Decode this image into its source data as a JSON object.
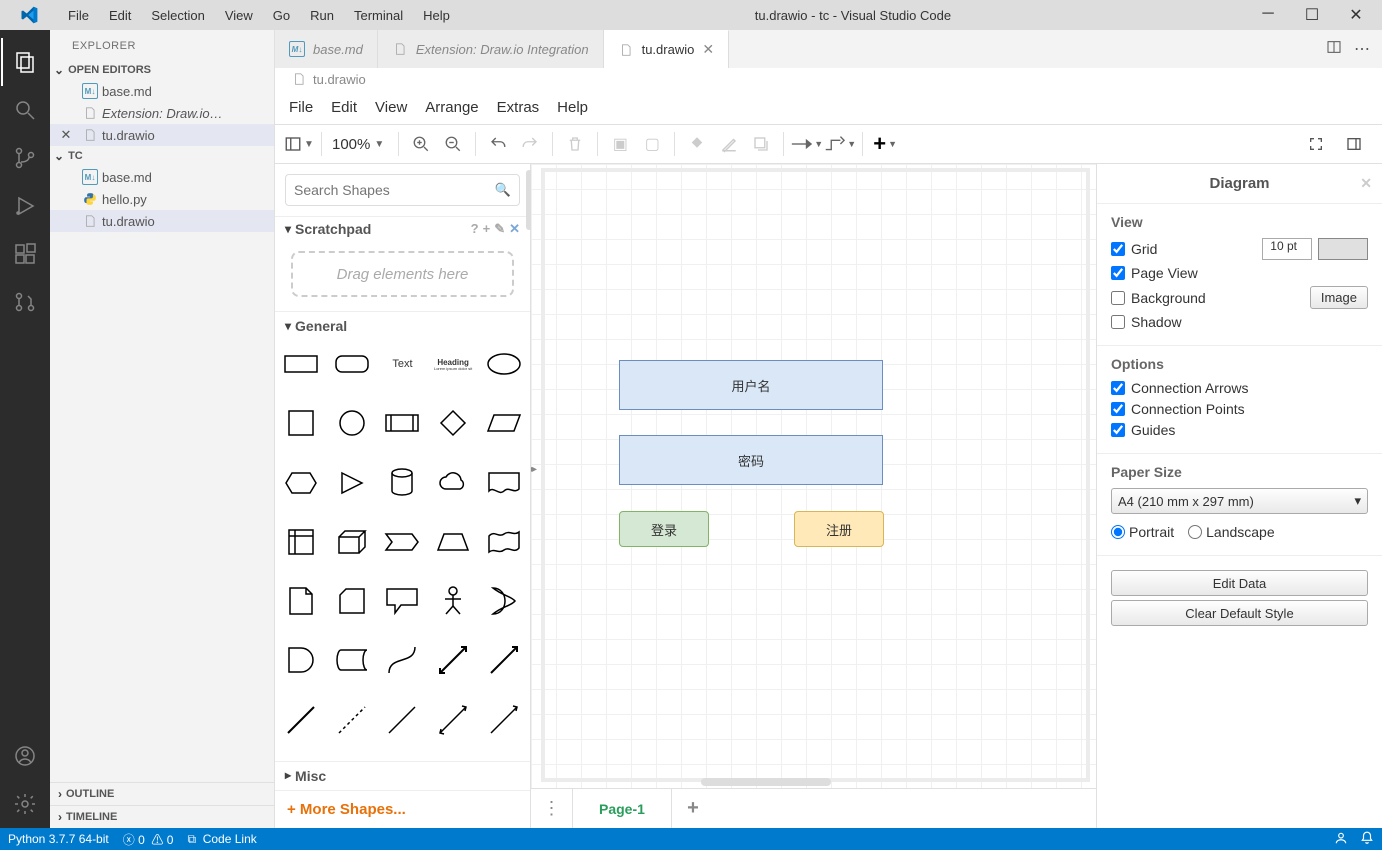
{
  "titlebar": {
    "menu": [
      "File",
      "Edit",
      "Selection",
      "View",
      "Go",
      "Run",
      "Terminal",
      "Help"
    ],
    "title": "tu.drawio - tc - Visual Studio Code"
  },
  "activitybar": {
    "explorer_icon": "explorer",
    "search_icon": "search",
    "git_icon": "source-control",
    "debug_icon": "run-debug",
    "extensions_icon": "extensions",
    "forks_icon": "remote-branches",
    "account_icon": "accounts",
    "settings_icon": "settings"
  },
  "sidebar": {
    "title": "EXPLORER",
    "open_editors_label": "OPEN EDITORS",
    "open_editors": [
      {
        "icon": "md",
        "name": "base.md",
        "italic": false
      },
      {
        "icon": "file",
        "name": "Extension: Draw.io…",
        "italic": true
      },
      {
        "icon": "file",
        "name": "tu.drawio",
        "italic": false,
        "close": true,
        "active": true
      }
    ],
    "folder_label": "TC",
    "files": [
      {
        "icon": "md",
        "name": "base.md"
      },
      {
        "icon": "py",
        "name": "hello.py"
      },
      {
        "icon": "file",
        "name": "tu.drawio",
        "active": true
      }
    ],
    "outline_label": "OUTLINE",
    "timeline_label": "TIMELINE"
  },
  "tabs": [
    {
      "icon": "md",
      "label": "base.md",
      "italic": true
    },
    {
      "icon": "file",
      "label": "Extension: Draw.io Integration",
      "italic": true
    },
    {
      "icon": "file",
      "label": "tu.drawio",
      "active": true,
      "close": true
    }
  ],
  "breadcrumb": {
    "icon": "file",
    "name": "tu.drawio"
  },
  "drawio": {
    "menu": [
      "File",
      "Edit",
      "View",
      "Arrange",
      "Extras",
      "Help"
    ],
    "zoom": "100%",
    "search_placeholder": "Search Shapes",
    "scratchpad_label": "Scratchpad",
    "scratch_drop_hint": "Drag elements here",
    "general_label": "General",
    "text_shape_label": "Text",
    "heading_shape_label": "Heading",
    "misc_label": "Misc",
    "more_shapes_label": "+  More Shapes...",
    "shapes": {
      "username": "用户名",
      "password": "密码",
      "login": "登录",
      "register": "注册"
    },
    "page_name": "Page-1",
    "format": {
      "diagram_title": "Diagram",
      "view_label": "View",
      "grid_label": "Grid",
      "grid_value": "10 pt",
      "pageview_label": "Page View",
      "background_label": "Background",
      "image_btn": "Image",
      "shadow_label": "Shadow",
      "options_label": "Options",
      "conn_arrows_label": "Connection Arrows",
      "conn_points_label": "Connection Points",
      "guides_label": "Guides",
      "paper_label": "Paper Size",
      "paper_value": "A4 (210 mm x 297 mm)",
      "portrait_label": "Portrait",
      "landscape_label": "Landscape",
      "edit_data_btn": "Edit Data",
      "clear_style_btn": "Clear Default Style"
    }
  },
  "statusbar": {
    "python": "Python 3.7.7 64-bit",
    "errors": "0",
    "warnings": "0",
    "link": "Code Link"
  }
}
